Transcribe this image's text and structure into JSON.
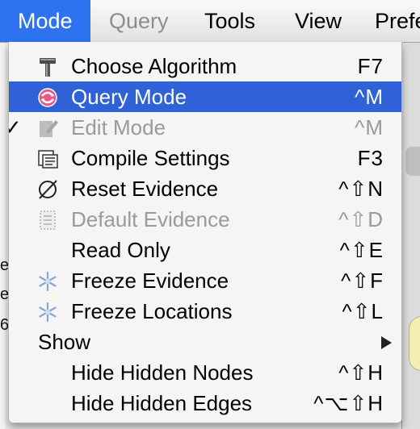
{
  "menubar": {
    "items": [
      {
        "label": "Mode",
        "state": "active"
      },
      {
        "label": "Query",
        "state": "disabled"
      },
      {
        "label": "Tools",
        "state": "normal"
      },
      {
        "label": "View",
        "state": "normal"
      },
      {
        "label": "Prefe",
        "state": "normal"
      }
    ]
  },
  "menu": {
    "items": [
      {
        "label": "Choose Algorithm",
        "shortcut": "F7",
        "icon": "hammer-icon",
        "state": "normal"
      },
      {
        "label": "Query Mode",
        "shortcut": "^M",
        "icon": "query-mode-icon",
        "state": "highlighted"
      },
      {
        "label": "Edit Mode",
        "shortcut": "^M",
        "icon": "edit-mode-icon",
        "state": "disabled",
        "checked": true
      },
      {
        "label": "Compile Settings",
        "shortcut": "F3",
        "icon": "compile-settings-icon",
        "state": "normal"
      },
      {
        "label": "Reset Evidence",
        "shortcut": "^⇧N",
        "icon": "empty-set-icon",
        "state": "normal"
      },
      {
        "label": "Default Evidence",
        "shortcut": "^⇧D",
        "icon": "default-evidence-icon",
        "state": "disabled"
      },
      {
        "label": "Read Only",
        "shortcut": "^⇧E",
        "icon": "",
        "state": "normal"
      },
      {
        "label": "Freeze Evidence",
        "shortcut": "^⇧F",
        "icon": "snowflake-icon",
        "state": "normal"
      },
      {
        "label": "Freeze Locations",
        "shortcut": "^⇧L",
        "icon": "snowflake-icon",
        "state": "normal"
      },
      {
        "label": "Show",
        "shortcut": "",
        "icon": "",
        "state": "submenu"
      },
      {
        "label": "Hide Hidden Nodes",
        "shortcut": "^⇧H",
        "icon": "",
        "state": "normal"
      },
      {
        "label": "Hide Hidden Edges",
        "shortcut": "^⌥⇧H",
        "icon": "",
        "state": "normal"
      }
    ]
  },
  "background": {
    "letters": [
      "e",
      "e",
      "6"
    ]
  }
}
